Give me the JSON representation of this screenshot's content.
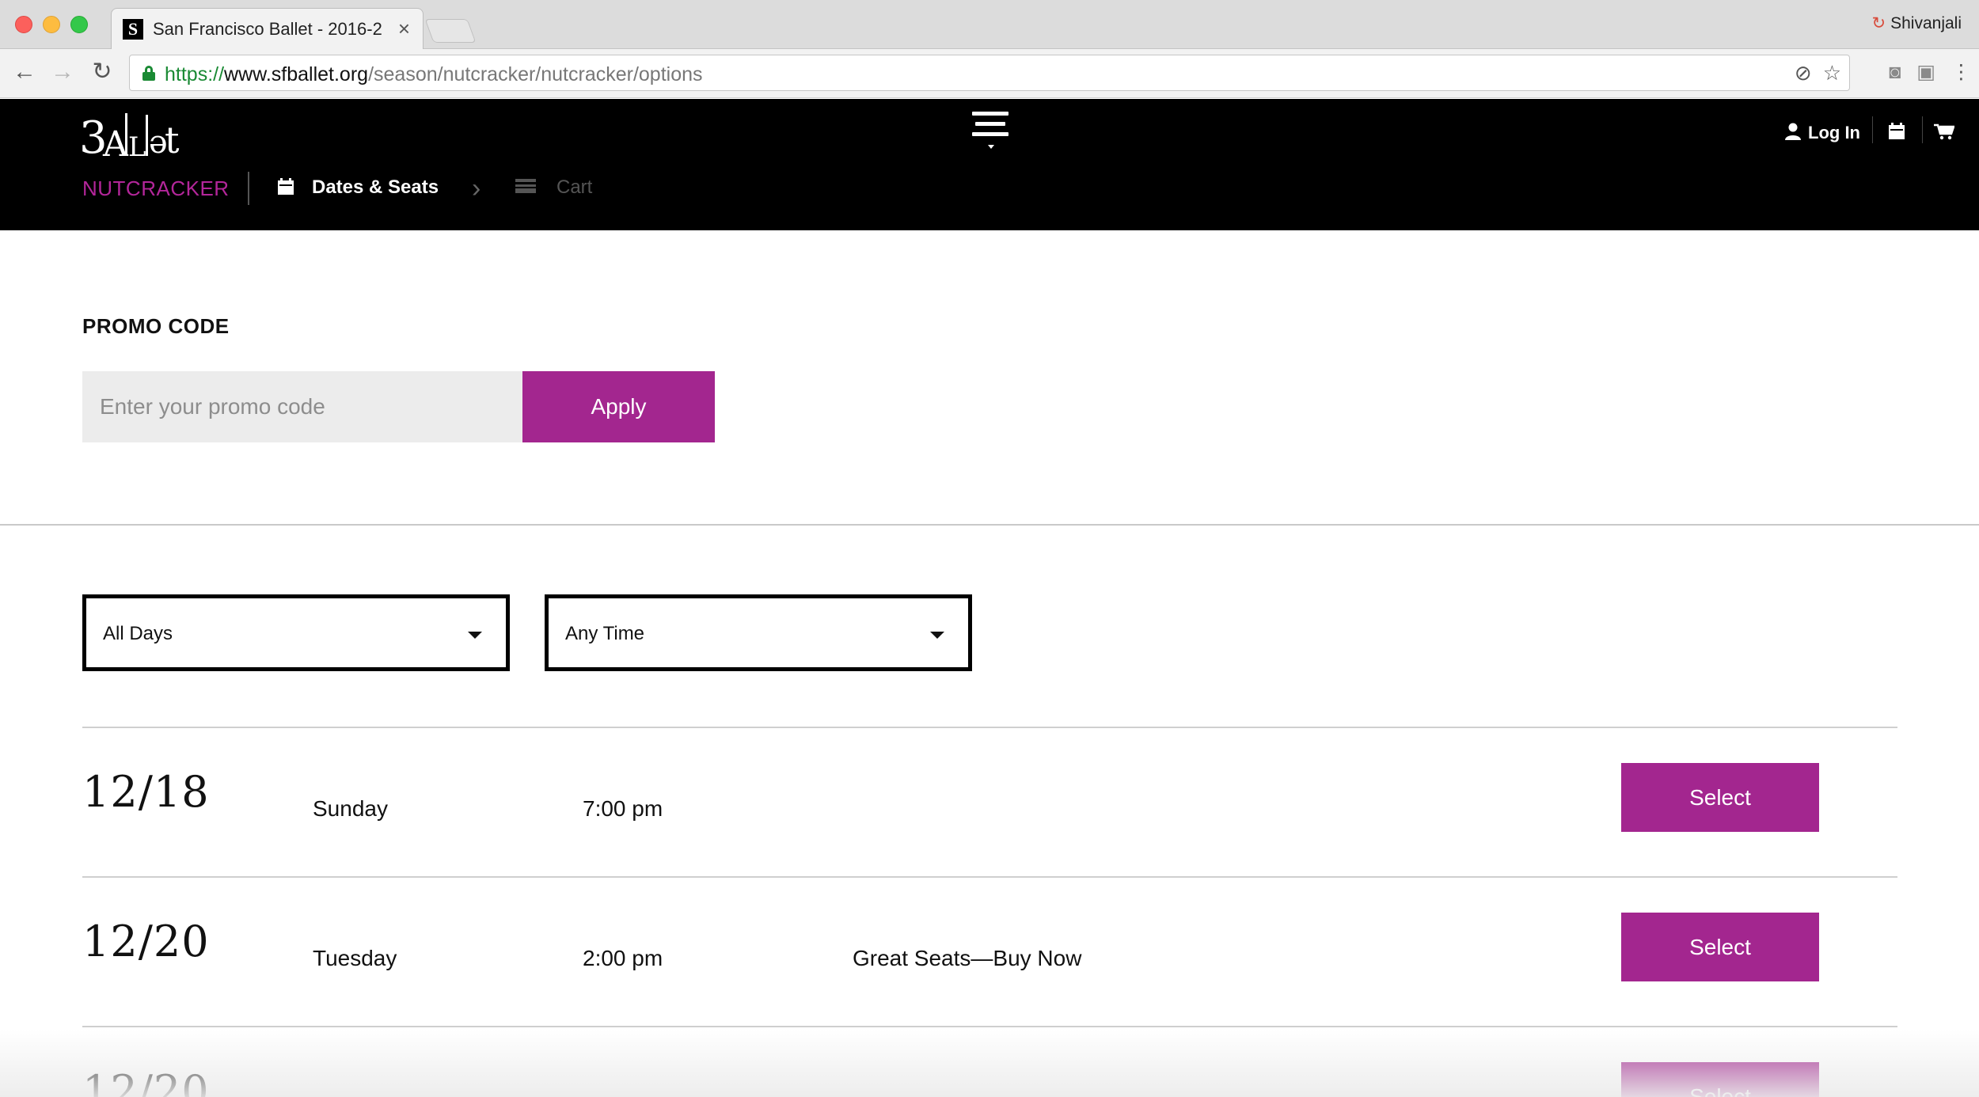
{
  "browser": {
    "tab_title": "San Francisco Ballet - 2016-2",
    "tab_favicon": "S",
    "tab_close": "×",
    "profile_name": "Shivanjali",
    "url_scheme": "https://",
    "url_host": "www.sfballet.org",
    "url_path": "/season/nutcracker/nutcracker/options"
  },
  "header": {
    "logo_text": "BALLET",
    "login_label": "Log In",
    "show_name": "NUTCRACKER",
    "steps": [
      {
        "label": "Dates & Seats",
        "active": true
      },
      {
        "label": "Cart",
        "active": false
      }
    ]
  },
  "promo": {
    "title": "PROMO CODE",
    "placeholder": "Enter your promo code",
    "apply_label": "Apply"
  },
  "filters": {
    "days": "All Days",
    "time": "Any Time"
  },
  "performances": [
    {
      "date": "12/18",
      "day": "Sunday",
      "time": "7:00 pm",
      "note": "",
      "button": "Select"
    },
    {
      "date": "12/20",
      "day": "Tuesday",
      "time": "2:00 pm",
      "note": "Great Seats—Buy Now",
      "button": "Select"
    },
    {
      "date": "12/20",
      "day": "",
      "time": "",
      "note": "",
      "button": "Select"
    }
  ],
  "colors": {
    "accent": "#a3268f",
    "header_bg": "#000000",
    "show_name": "#b3269a"
  }
}
